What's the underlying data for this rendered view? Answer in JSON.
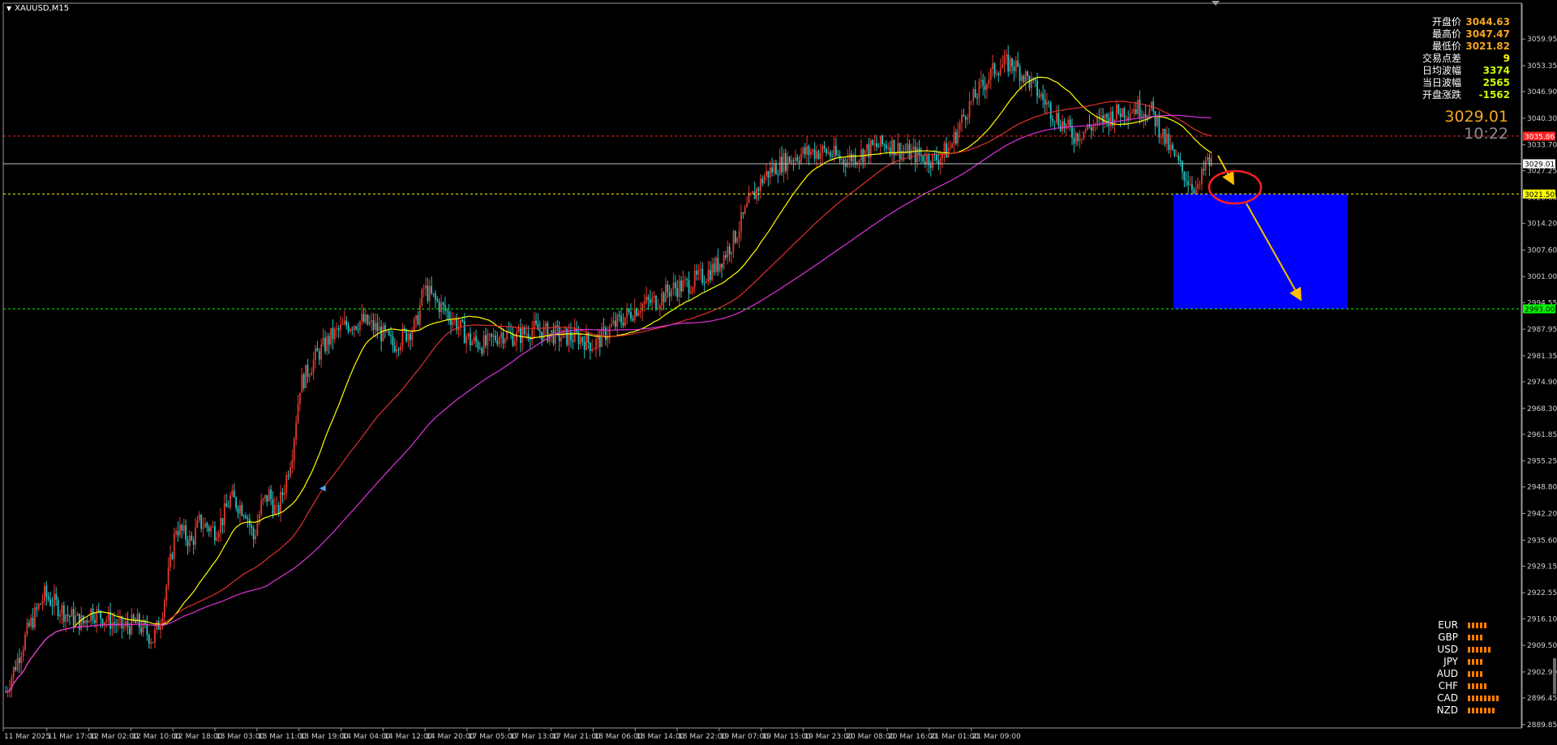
{
  "window": {
    "symbol_title": "XAUUSD,M15"
  },
  "info_panel": [
    {
      "label": "开盘价",
      "value": "3044.63",
      "color": "#f5a623"
    },
    {
      "label": "最高价",
      "value": "3047.47",
      "color": "#f5a623"
    },
    {
      "label": "最低价",
      "value": "3021.82",
      "color": "#f5a623"
    },
    {
      "label": "交易点差",
      "value": "9",
      "color": "#ffff00"
    },
    {
      "label": "日均波幅",
      "value": "3374",
      "color": "#c8ff00"
    },
    {
      "label": "当日波幅",
      "value": "2565",
      "color": "#c8ff00"
    },
    {
      "label": "开盘涨跌",
      "value": "-1562",
      "color": "#c8ff00"
    }
  ],
  "big_price": "3029.01",
  "timer": "10:22",
  "currency_strength": [
    {
      "name": "EUR",
      "level": 5
    },
    {
      "name": "GBP",
      "level": 4
    },
    {
      "name": "USD",
      "level": 6
    },
    {
      "name": "JPY",
      "level": 4
    },
    {
      "name": "AUD",
      "level": 4
    },
    {
      "name": "CHF",
      "level": 5
    },
    {
      "name": "CAD",
      "level": 8
    },
    {
      "name": "NZD",
      "level": 7
    }
  ],
  "colors": {
    "background": "#000000",
    "bull_candle": "#e23a2e",
    "bear_candle": "#28c4c4",
    "ma_fast": "#ffff00",
    "ma_mid": "#e03030",
    "ma_slow": "#dd33dd",
    "target_box": "#0000ff",
    "arrow": "#ffc000",
    "circle": "#ff2020",
    "strength_bar": "#ff7f00"
  },
  "chart_data": {
    "type": "candlestick",
    "symbol": "XAUUSD",
    "timeframe": "M15",
    "ylim": [
      2889.8,
      3062.8
    ],
    "y_ticks": [
      "3059.95",
      "3053.35",
      "3046.90",
      "3040.30",
      "3033.70",
      "3027.25",
      "3020.65",
      "3014.20",
      "3007.60",
      "3001.00",
      "2994.55",
      "2987.95",
      "2981.35",
      "2974.90",
      "2968.30",
      "2961.85",
      "2955.25",
      "2948.80",
      "2942.20",
      "2935.60",
      "2929.15",
      "2922.55",
      "2916.10",
      "2909.50",
      "2902.90",
      "2896.45",
      "2889.85"
    ],
    "x_ticks": [
      "11 Mar 2025",
      "11 Mar 17:00",
      "12 Mar 02:00",
      "12 Mar 10:00",
      "12 Mar 18:00",
      "13 Mar 03:00",
      "13 Mar 11:00",
      "13 Mar 19:00",
      "14 Mar 04:00",
      "14 Mar 12:00",
      "14 Mar 20:00",
      "17 Mar 05:00",
      "17 Mar 13:00",
      "17 Mar 21:00",
      "18 Mar 06:00",
      "18 Mar 14:00",
      "18 Mar 22:00",
      "19 Mar 07:00",
      "19 Mar 15:00",
      "19 Mar 23:00",
      "20 Mar 08:00",
      "20 Mar 16:00",
      "21 Mar 01:00",
      "21 Mar 09:00"
    ],
    "price_path": [
      [
        0,
        2898
      ],
      [
        3,
        2914
      ],
      [
        5,
        2922
      ],
      [
        8,
        2917
      ],
      [
        10,
        2915
      ],
      [
        11,
        2918
      ],
      [
        13,
        2916
      ],
      [
        15,
        2914
      ],
      [
        17,
        2915
      ],
      [
        19,
        2911
      ],
      [
        20,
        2916
      ],
      [
        21,
        2927
      ],
      [
        22,
        2939
      ],
      [
        24,
        2935
      ],
      [
        25,
        2940
      ],
      [
        27,
        2938
      ],
      [
        28,
        2941
      ],
      [
        29,
        2946
      ],
      [
        31,
        2943
      ],
      [
        32,
        2936
      ],
      [
        33,
        2944
      ],
      [
        34,
        2947
      ],
      [
        35,
        2942
      ],
      [
        36,
        2949
      ],
      [
        37,
        2958
      ],
      [
        38,
        2974
      ],
      [
        40,
        2981
      ],
      [
        42,
        2986
      ],
      [
        44,
        2989
      ],
      [
        46,
        2990
      ],
      [
        48,
        2988
      ],
      [
        50,
        2984
      ],
      [
        53,
        2989
      ],
      [
        54,
        2998
      ],
      [
        56,
        2994
      ],
      [
        58,
        2990
      ],
      [
        60,
        2985
      ],
      [
        62,
        2984
      ],
      [
        64,
        2987
      ],
      [
        66,
        2986
      ],
      [
        68,
        2988
      ],
      [
        70,
        2987
      ],
      [
        72,
        2986
      ],
      [
        74,
        2986
      ],
      [
        76,
        2984
      ],
      [
        78,
        2988
      ],
      [
        80,
        2991
      ],
      [
        82,
        2994
      ],
      [
        84,
        2995
      ],
      [
        86,
        2998
      ],
      [
        88,
        2999
      ],
      [
        90,
        3001
      ],
      [
        92,
        3004
      ],
      [
        94,
        3010
      ],
      [
        96,
        3019
      ],
      [
        98,
        3026
      ],
      [
        100,
        3029
      ],
      [
        102,
        3031
      ],
      [
        104,
        3032
      ],
      [
        106,
        3032
      ],
      [
        108,
        3030
      ],
      [
        110,
        3031
      ],
      [
        112,
        3033
      ],
      [
        114,
        3034
      ],
      [
        116,
        3032
      ],
      [
        118,
        3031
      ],
      [
        120,
        3030
      ],
      [
        122,
        3033
      ],
      [
        124,
        3042
      ],
      [
        126,
        3048
      ],
      [
        128,
        3053
      ],
      [
        130,
        3054
      ],
      [
        132,
        3050
      ],
      [
        134,
        3045
      ],
      [
        136,
        3040
      ],
      [
        138,
        3036
      ],
      [
        140,
        3038
      ],
      [
        142,
        3040
      ],
      [
        144,
        3042
      ],
      [
        146,
        3043
      ],
      [
        148,
        3042
      ],
      [
        150,
        3034
      ],
      [
        152,
        3027
      ],
      [
        154,
        3022
      ],
      [
        155,
        3029
      ]
    ],
    "moving_averages": [
      {
        "name": "MA fast",
        "color": "#ffff00",
        "period": 9
      },
      {
        "name": "MA mid",
        "color": "#e03030",
        "period": 20
      },
      {
        "name": "MA slow",
        "color": "#dd33dd",
        "period": 34
      }
    ],
    "horizontal_lines": [
      {
        "price": 3035.86,
        "label": "3035.86",
        "color": "#ff2020",
        "style": "dashed"
      },
      {
        "price": 3029.01,
        "label": "3029.01",
        "color": "#c0c0c0",
        "style": "solid"
      },
      {
        "price": 3021.5,
        "label": "3021.50",
        "color": "#ffff00",
        "style": "dashed"
      },
      {
        "price": 2993.0,
        "label": "2993.00",
        "color": "#00ff00",
        "style": "dashed"
      }
    ],
    "target_zone": {
      "price_top": 3021.5,
      "price_bottom": 2993.0,
      "color": "#0000ff"
    },
    "grid": false,
    "legend": "none"
  }
}
